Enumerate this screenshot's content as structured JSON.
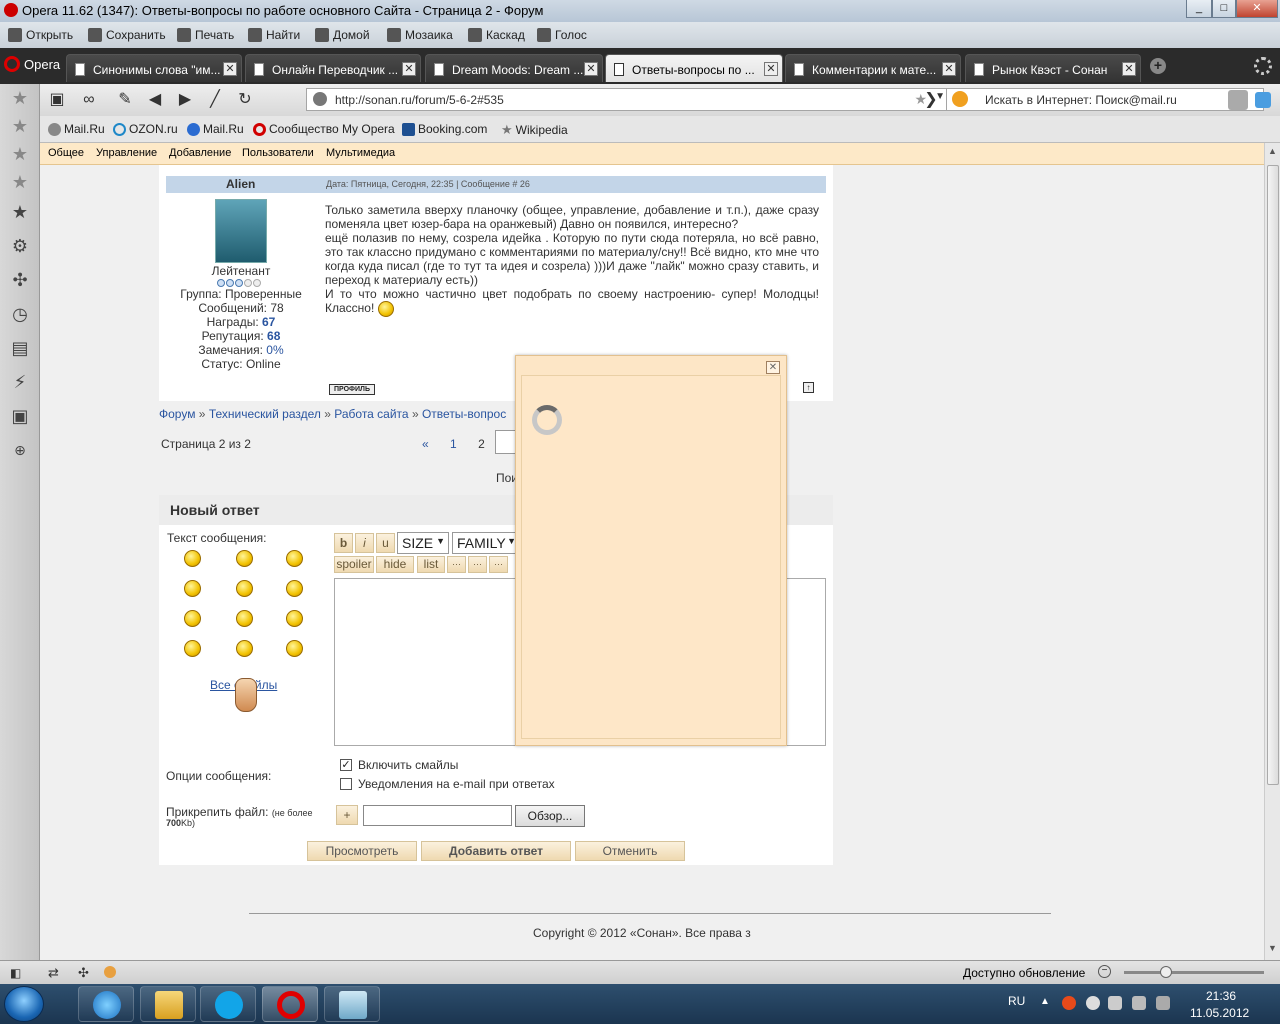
{
  "window": {
    "title": "Opera 11.62 (1347): Ответы-вопросы по работе основного Сайта - Страница 2 - Форум",
    "controls": [
      "_",
      "□",
      "✕"
    ]
  },
  "toolbar": {
    "items": [
      "Открыть",
      "Сохранить",
      "Печать",
      "Найти",
      "Домой",
      "Мозаика",
      "Каскад",
      "Голос"
    ]
  },
  "tabs": {
    "menu_label": "Opera",
    "items": [
      {
        "label": "Синонимы слова \"им..."
      },
      {
        "label": "Онлайн Переводчик ..."
      },
      {
        "label": "Dream Moods: Dream ..."
      },
      {
        "label": "Ответы-вопросы по ..."
      },
      {
        "label": "Комментарии к мате..."
      },
      {
        "label": "Рынок Квэст - Сонан"
      }
    ],
    "active_index": 3
  },
  "navigation": {
    "address": "http://sonan.ru/forum/5-6-2#535",
    "search_placeholder": "Искать в Интернет: Поиск@mail.ru"
  },
  "bookmarks": [
    {
      "label": "Mail.Ru",
      "color": "#2a6bd1"
    },
    {
      "label": "OZON.ru",
      "color": "#1e88c8"
    },
    {
      "label": "Mail.Ru",
      "color": "#2a6bd1"
    },
    {
      "label": "Сообщество My Opera",
      "color": "#d10000"
    },
    {
      "label": "Booking.com",
      "color": "#1d4f91"
    },
    {
      "label": "Wikipedia",
      "color": "#777777"
    }
  ],
  "userbar": {
    "items": [
      "Общее",
      "Управление",
      "Добавление",
      "Пользователи",
      "Мультимедиа"
    ]
  },
  "post": {
    "author": "Alien",
    "date": "Дата: Пятница, Сегодня, 22:35 | Сообщение # 26",
    "rank": "Лейтенант",
    "group": "Группа: Проверенные",
    "messages": "Сообщений: 78",
    "awards_label": "Награды:",
    "awards_value": "67",
    "reputation_label": "Репутация:",
    "reputation_value": "68",
    "warnings_label": "Замечания:",
    "warnings_value": "0%",
    "status": "Статус: Online",
    "text": "Только заметила вверху планочку (общее, управление, добавление и т.п.), даже сразу поменяла цвет юзер-бара на оранжевый) Давно он появился, интересно?\nещё полазив по нему, созрела идейка . Которую по пути сюда потеряла, но всё равно, это так классно придумано с комментариями по материалу/сну!! Всё видно, кто мне что когда куда писал (где то тут та идея и созрела) )))И даже \"лайк\" можно сразу ставить, и переход к материалу есть))\nИ то что можно частично цвет подобрать по своему настроению- супер! Молодцы! Классно!",
    "profile_button": "ПРОФИЛЬ",
    "top_button": "↑"
  },
  "breadcrumb": {
    "items": [
      "Форум",
      "Технический раздел",
      "Работа сайта",
      "Ответы-вопрос"
    ],
    "separator": "»"
  },
  "pagination": {
    "info": "Страница 2 из 2",
    "prev": "«",
    "pages": [
      "1",
      "2"
    ],
    "search_prefix": "Пои"
  },
  "reply": {
    "title": "Новый ответ",
    "message_label": "Текст сообщения:",
    "all_smiles": "Все смайлы",
    "format_buttons": [
      "b",
      "i",
      "u"
    ],
    "size_select": "SIZE",
    "family_select": "FAMILY",
    "format_buttons_row2": [
      "spoiler",
      "hide",
      "list",
      "···",
      "···",
      "···"
    ],
    "options_label": "Опции сообщения:",
    "option_smiles": "Включить смайлы",
    "option_smiles_checked": true,
    "option_email": "Уведомления на e-mail при ответах",
    "option_email_checked": false,
    "attach_label": "Прикрепить файл:",
    "attach_note": "(не более",
    "attach_limit": "700",
    "attach_unit": "Kb)",
    "add_file": "+",
    "browse": "Обзор...",
    "preview_button": "Просмотреть",
    "submit_button": "Добавить ответ",
    "cancel_button": "Отменить"
  },
  "footer": {
    "copyright": "Copyright © 2012 «Сонан». Все права з"
  },
  "popup": {
    "close": "✕"
  },
  "statusbar": {
    "text": "Доступно обновление"
  },
  "taskbar": {
    "lang": "RU",
    "time": "21:36",
    "date": "11.05.2012"
  }
}
